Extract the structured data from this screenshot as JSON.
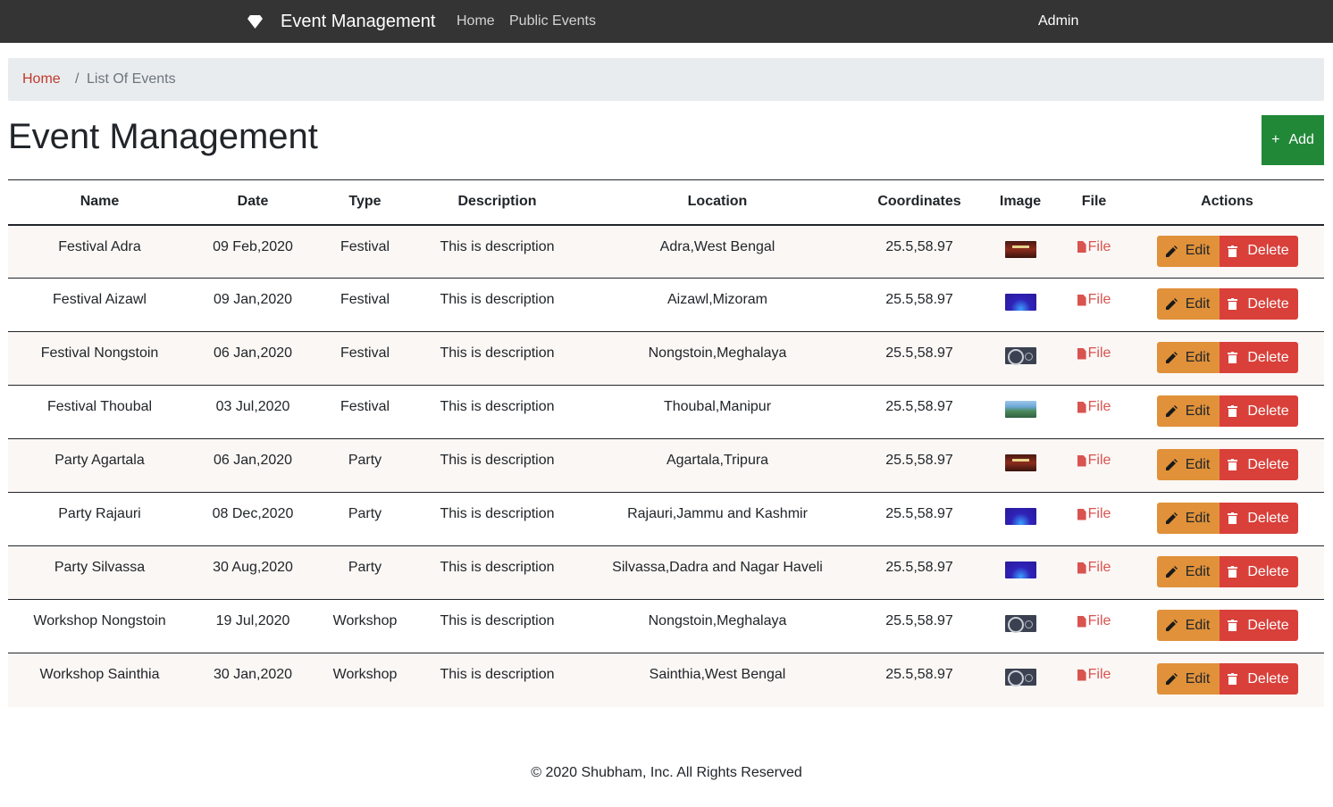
{
  "navbar": {
    "brand": "Event Management",
    "brand_icon": "diamond-icon",
    "links": [
      "Home",
      "Public Events"
    ],
    "user": "Admin"
  },
  "breadcrumb": {
    "home": "Home",
    "separator": "/",
    "current": "List Of Events"
  },
  "page": {
    "title": "Event Management",
    "add_label": "Add",
    "add_icon": "plus-icon"
  },
  "table": {
    "headers": [
      "Name",
      "Date",
      "Type",
      "Description",
      "Location",
      "Coordinates",
      "Image",
      "File",
      "Actions"
    ],
    "rows": [
      {
        "name": "Festival Adra",
        "date": "09 Feb,2020",
        "type": "Festival",
        "description": "This is description",
        "location": "Adra,West Bengal",
        "coordinates": "25.5,58.97",
        "image": "festival-poster",
        "file": "File"
      },
      {
        "name": "Festival Aizawl",
        "date": "09 Jan,2020",
        "type": "Festival",
        "description": "This is description",
        "location": "Aizawl,Mizoram",
        "coordinates": "25.5,58.97",
        "image": "purple-banner",
        "file": "File"
      },
      {
        "name": "Festival Nongstoin",
        "date": "06 Jan,2020",
        "type": "Festival",
        "description": "This is description",
        "location": "Nongstoin,Meghalaya",
        "coordinates": "25.5,58.97",
        "image": "seal-banner",
        "file": "File"
      },
      {
        "name": "Festival Thoubal",
        "date": "03 Jul,2020",
        "type": "Festival",
        "description": "This is description",
        "location": "Thoubal,Manipur",
        "coordinates": "25.5,58.97",
        "image": "landscape",
        "file": "File"
      },
      {
        "name": "Party Agartala",
        "date": "06 Jan,2020",
        "type": "Party",
        "description": "This is description",
        "location": "Agartala,Tripura",
        "coordinates": "25.5,58.97",
        "image": "festival-poster",
        "file": "File"
      },
      {
        "name": "Party Rajauri",
        "date": "08 Dec,2020",
        "type": "Party",
        "description": "This is description",
        "location": "Rajauri,Jammu and Kashmir",
        "coordinates": "25.5,58.97",
        "image": "purple-banner",
        "file": "File"
      },
      {
        "name": "Party Silvassa",
        "date": "30 Aug,2020",
        "type": "Party",
        "description": "This is description",
        "location": "Silvassa,Dadra and Nagar Haveli",
        "coordinates": "25.5,58.97",
        "image": "purple-banner",
        "file": "File"
      },
      {
        "name": "Workshop Nongstoin",
        "date": "19 Jul,2020",
        "type": "Workshop",
        "description": "This is description",
        "location": "Nongstoin,Meghalaya",
        "coordinates": "25.5,58.97",
        "image": "seal-banner",
        "file": "File"
      },
      {
        "name": "Workshop Sainthia",
        "date": "30 Jan,2020",
        "type": "Workshop",
        "description": "This is description",
        "location": "Sainthia,West Bengal",
        "coordinates": "25.5,58.97",
        "image": "seal-banner",
        "file": "File"
      }
    ],
    "edit_label": "Edit",
    "delete_label": "Delete"
  },
  "footer": {
    "text": "© 2020 Shubham, Inc. All Rights Reserved"
  },
  "colors": {
    "navbar_bg": "#343434",
    "add_button": "#218838",
    "edit_button": "#e0913a",
    "delete_button": "#d9403a",
    "link_red": "#d9534f"
  }
}
